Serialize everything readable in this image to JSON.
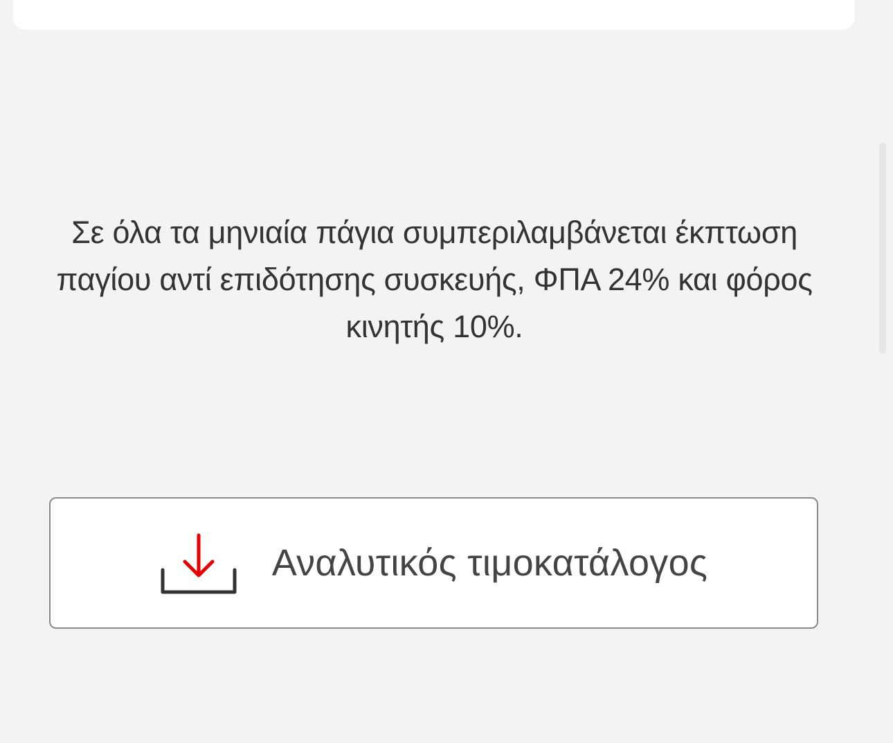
{
  "disclaimer": {
    "text": "Σε όλα τα μηνιαία πάγια συμπεριλαμβάνεται έκπτωση παγίου αντί επιδότησης συσκευής, ΦΠΑ 24% και φόρος κινητής 10%."
  },
  "download_button": {
    "label": "Αναλυτικός τιμοκατάλογος",
    "icon": "download-icon"
  },
  "colors": {
    "background": "#f3f3f3",
    "accent": "#e60000",
    "text": "#333333",
    "border": "#8a8a8a"
  }
}
